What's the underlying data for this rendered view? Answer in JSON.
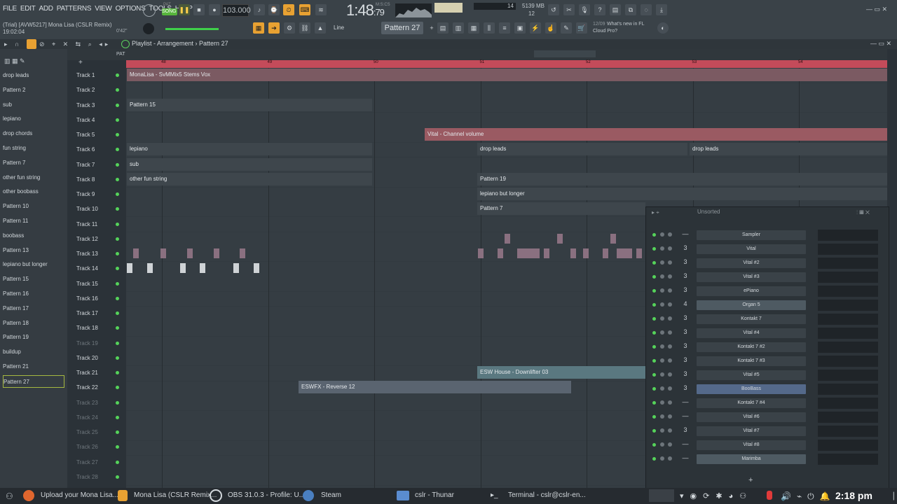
{
  "menu": [
    "FILE",
    "EDIT",
    "ADD",
    "PATTERNS",
    "VIEW",
    "OPTIONS",
    "TOOLS",
    "HELP"
  ],
  "transport": {
    "pat_label": "PAT",
    "song_label": "SONG",
    "tempo": "103.000",
    "clock": "1:48",
    "clock_sub": ":79",
    "clock_unit": "M:S:CS",
    "voices": "14",
    "mem": "5139 MB",
    "poly": "12"
  },
  "song": {
    "title": "(Trial) [AVW5217] Mona Lisa (CSLR Remix)",
    "time": "19:02:04",
    "pos": "0'42\""
  },
  "toolbar": {
    "snap": "Line",
    "pattern": "Pattern 27"
  },
  "news": {
    "date": "12/09",
    "text": "What's new in FL",
    "sub": "Cloud Pro?"
  },
  "playlist": {
    "title": "Playlist - Arrangement",
    "breadcrumb": "Pattern 27"
  },
  "browser_items": [
    "drop leads",
    "Pattern 2",
    "sub",
    "lepiano",
    "drop chords",
    "fun string",
    "Pattern 7",
    "other fun string",
    "other boobass",
    "Pattern 10",
    "Pattern 11",
    "boobass",
    "Pattern 13",
    "lepiano but longer",
    "Pattern 15",
    "Pattern 16",
    "Pattern 17",
    "Pattern 18",
    "Pattern 19",
    "buildup",
    "Pattern 21",
    "Pattern 27"
  ],
  "tracks": [
    "Track 1",
    "Track 2",
    "Track 3",
    "Track 4",
    "Track 5",
    "Track 6",
    "Track 7",
    "Track 8",
    "Track 9",
    "Track 10",
    "Track 11",
    "Track 12",
    "Track 13",
    "Track 14",
    "Track 15",
    "Track 16",
    "Track 17",
    "Track 18",
    "Track 19",
    "Track 20",
    "Track 21",
    "Track 22",
    "Track 23",
    "Track 24",
    "Track 25",
    "Track 26",
    "Track 27",
    "Track 28"
  ],
  "timeline_bars": [
    "48",
    "49",
    "50",
    "51",
    "52",
    "53",
    "54"
  ],
  "clips": {
    "vox": "MonaLisa - SvMMix5 Stems Vox",
    "p15": "Pattern 15",
    "vital_auto": "Vital - Channel volume",
    "lepiano": "lepiano",
    "drop_leads_1": "drop leads",
    "drop_leads_2": "drop leads",
    "sub": "sub",
    "other_fun": "other fun string",
    "p19": "Pattern 19",
    "lepiano_longer": "lepiano but longer",
    "p7": "Pattern 7",
    "esw_house": "ESW House - Downlifter 03",
    "eswfx": "ESWFX - Reverse 12"
  },
  "rack": {
    "title": "Unsorted",
    "channels": [
      {
        "route": "—",
        "name": "Sampler"
      },
      {
        "route": "3",
        "name": "Vital"
      },
      {
        "route": "3",
        "name": "Vital #2"
      },
      {
        "route": "3",
        "name": "Vital #3"
      },
      {
        "route": "3",
        "name": "ePiano"
      },
      {
        "route": "4",
        "name": "Organ 5"
      },
      {
        "route": "3",
        "name": "Kontakt 7"
      },
      {
        "route": "3",
        "name": "Vital #4"
      },
      {
        "route": "3",
        "name": "Kontakt 7 #2"
      },
      {
        "route": "3",
        "name": "Kontakt 7 #3"
      },
      {
        "route": "3",
        "name": "Vital #5"
      },
      {
        "route": "3",
        "name": "BooBass"
      },
      {
        "route": "—",
        "name": "Kontakt 7 #4"
      },
      {
        "route": "—",
        "name": "Vital #6"
      },
      {
        "route": "3",
        "name": "Vital #7"
      },
      {
        "route": "—",
        "name": "Vital #8"
      },
      {
        "route": "—",
        "name": "Marimba"
      }
    ],
    "add": "+"
  },
  "taskbar": {
    "items": [
      "Upload your Mona Lisa...",
      "Mona Lisa (CSLR Remix...",
      "OBS 31.0.3 - Profile: U...",
      "Steam",
      "cslr - Thunar",
      "Terminal - cslr@cslr-en..."
    ],
    "time": "2:18 pm"
  }
}
